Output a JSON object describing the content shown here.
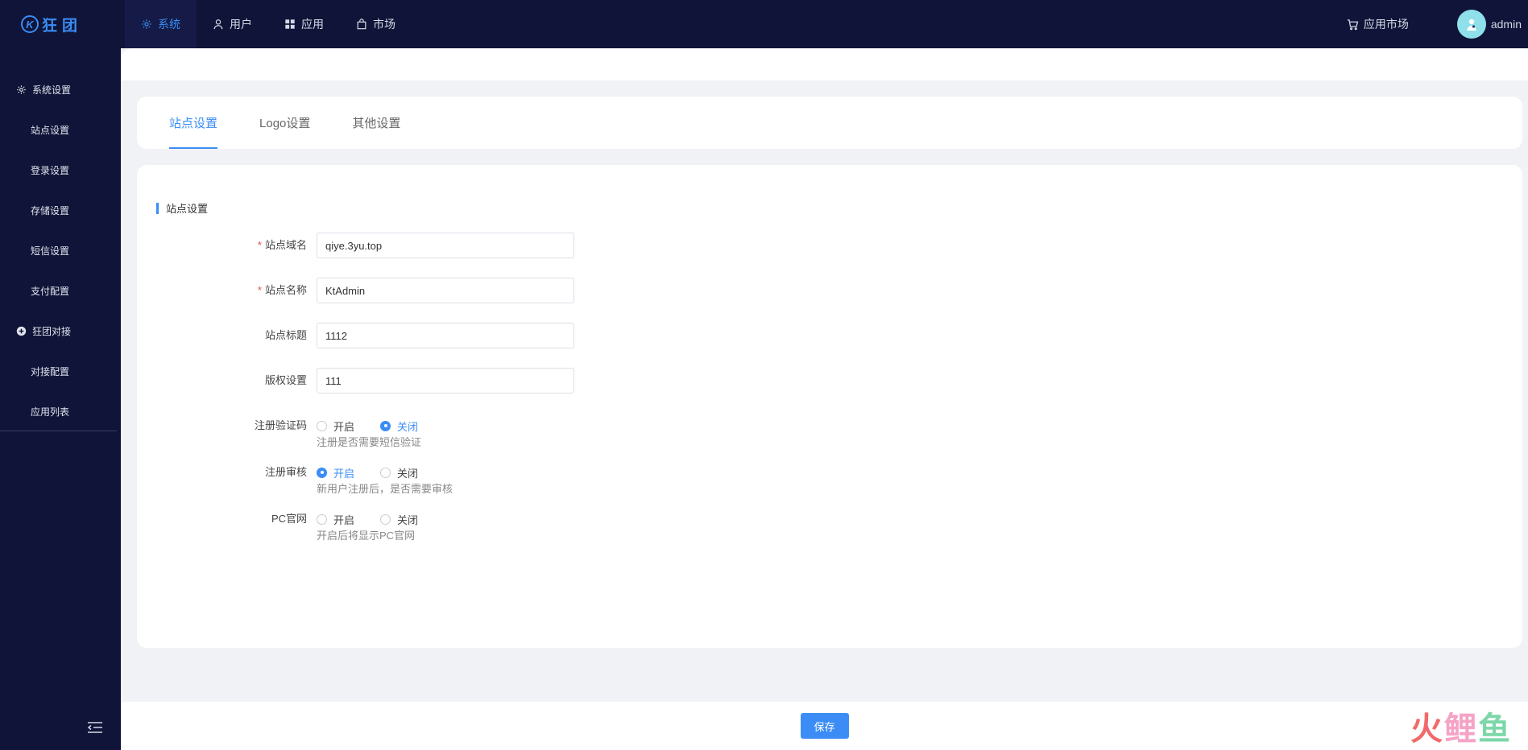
{
  "brand": {
    "name": "狂团",
    "mark": "K"
  },
  "topnav": [
    {
      "label": "系统",
      "icon": "gear-icon",
      "active": true
    },
    {
      "label": "用户",
      "icon": "user-icon",
      "active": false
    },
    {
      "label": "应用",
      "icon": "grid-icon",
      "active": false
    },
    {
      "label": "市场",
      "icon": "bag-icon",
      "active": false
    }
  ],
  "topright": {
    "market_label": "应用市场",
    "username": "admin"
  },
  "sidebar": {
    "group1": {
      "label": "系统设置",
      "icon": "gear-icon"
    },
    "items1": [
      "站点设置",
      "登录设置",
      "存储设置",
      "短信设置",
      "支付配置"
    ],
    "group2": {
      "label": "狂团对接",
      "icon": "plus-circle-icon"
    },
    "items2": [
      "对接配置",
      "应用列表"
    ]
  },
  "tabs": [
    {
      "label": "站点设置",
      "active": true
    },
    {
      "label": "Logo设置",
      "active": false
    },
    {
      "label": "其他设置",
      "active": false
    }
  ],
  "form": {
    "section_title": "站点设置",
    "domain": {
      "label": "站点域名",
      "required": true,
      "value": "qiye.3yu.top"
    },
    "name": {
      "label": "站点名称",
      "required": true,
      "value": "KtAdmin"
    },
    "title": {
      "label": "站点标题",
      "required": false,
      "value": "1112"
    },
    "copyright": {
      "label": "版权设置",
      "required": false,
      "value": "111"
    },
    "reg_captcha": {
      "label": "注册验证码",
      "on": "开启",
      "off": "关闭",
      "selected": "off",
      "hint": "注册是否需要短信验证"
    },
    "reg_review": {
      "label": "注册审核",
      "on": "开启",
      "off": "关闭",
      "selected": "on",
      "hint": "新用户注册后，是否需要审核"
    },
    "pc_site": {
      "label": "PC官网",
      "on": "开启",
      "off": "关闭",
      "selected": "none",
      "hint": "开启后将显示PC官网"
    }
  },
  "footer": {
    "save_label": "保存"
  },
  "watermark": {
    "chars": [
      "火",
      "鲤",
      "鱼"
    ],
    "colors": [
      "#f05a5a",
      "#f49ac1",
      "#6fd3a0"
    ]
  },
  "colors": {
    "primary": "#3b8df5",
    "nav_bg": "#0f1438"
  }
}
